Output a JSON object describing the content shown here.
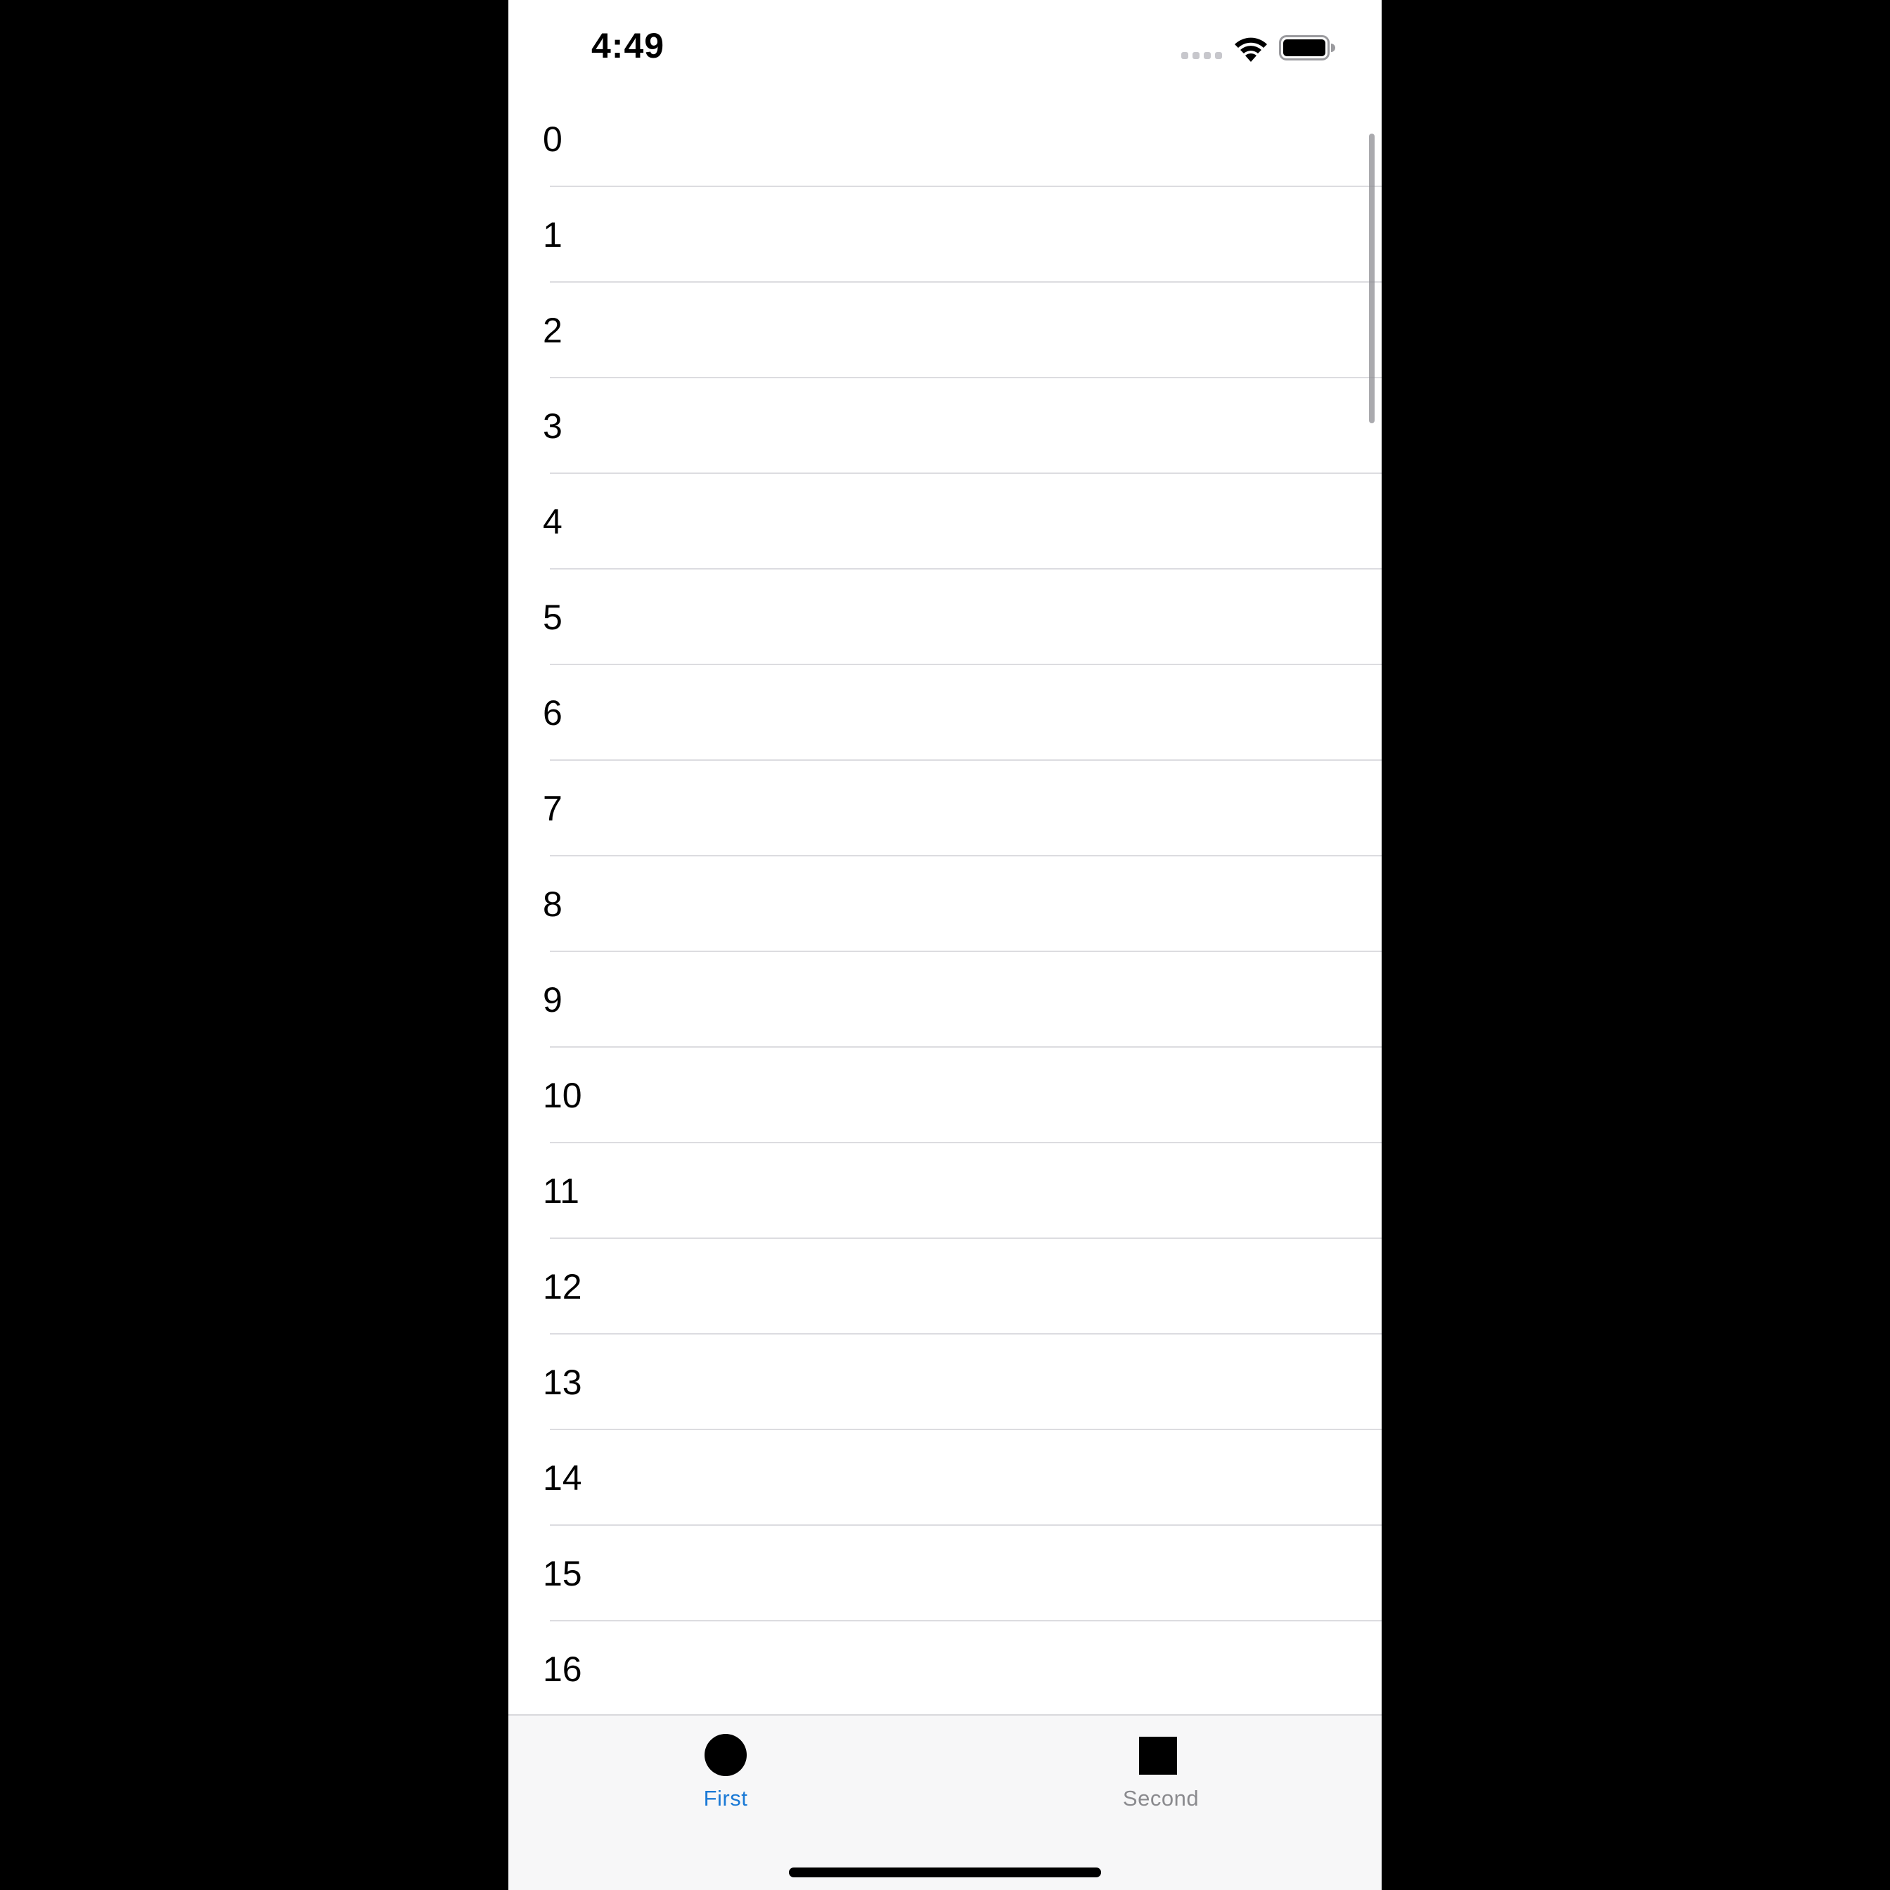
{
  "status_bar": {
    "time": "4:49",
    "signal_icon": "cellular-signal-icon",
    "wifi_icon": "wifi-icon",
    "battery_icon": "battery-full-icon"
  },
  "list": {
    "items": [
      {
        "label": "0"
      },
      {
        "label": "1"
      },
      {
        "label": "2"
      },
      {
        "label": "3"
      },
      {
        "label": "4"
      },
      {
        "label": "5"
      },
      {
        "label": "6"
      },
      {
        "label": "7"
      },
      {
        "label": "8"
      },
      {
        "label": "9"
      },
      {
        "label": "10"
      },
      {
        "label": "11"
      },
      {
        "label": "12"
      },
      {
        "label": "13"
      },
      {
        "label": "14"
      },
      {
        "label": "15"
      },
      {
        "label": "16"
      }
    ]
  },
  "tab_bar": {
    "tabs": [
      {
        "label": "First",
        "icon": "circle-icon",
        "selected": true
      },
      {
        "label": "Second",
        "icon": "square-icon",
        "selected": false
      }
    ],
    "selected_color": "#1b7ad6",
    "unselected_color": "#8a8a8e"
  }
}
